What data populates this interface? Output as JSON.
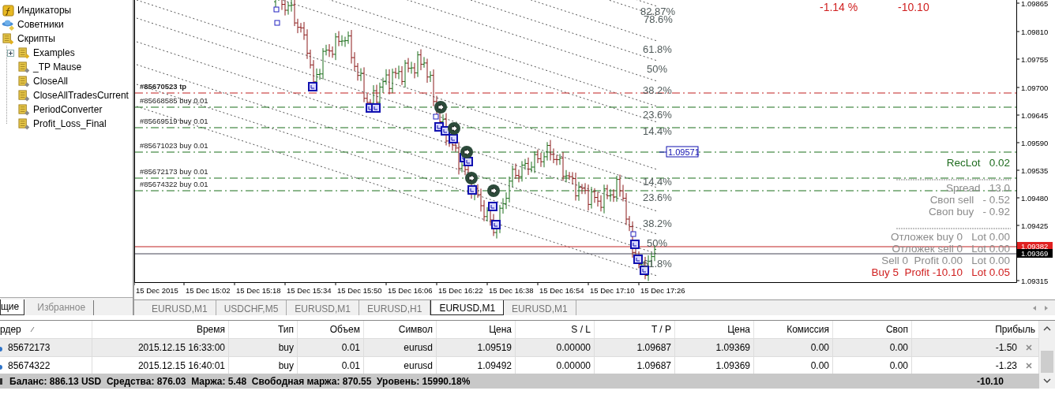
{
  "navigator": {
    "tree": [
      {
        "kind": "indicators",
        "label": "Индикаторы"
      },
      {
        "kind": "experts",
        "label": "Советники"
      },
      {
        "kind": "scripts",
        "label": "Скрипты",
        "children": [
          {
            "kind": "folder",
            "label": "Examples",
            "expanded": false
          },
          {
            "kind": "script",
            "label": "_TP Mause"
          },
          {
            "kind": "script",
            "label": "CloseAll"
          },
          {
            "kind": "script",
            "label": "CloseAllTradesCurrent"
          },
          {
            "kind": "script",
            "label": "PeriodConverter"
          },
          {
            "kind": "script",
            "label": "Profit_Loss_Final"
          }
        ]
      }
    ],
    "tabs": [
      {
        "label": "щие",
        "selected": true
      },
      {
        "label": "Избранное",
        "selected": false
      }
    ]
  },
  "chart": {
    "header": {
      "percent": "-1.14 %",
      "profit": "-10.10"
    },
    "order_lines": [
      {
        "kind": "take_profit",
        "label": "#85670523 tp"
      },
      {
        "kind": "buy",
        "label": "#85668585 buy 0.01"
      },
      {
        "kind": "buy",
        "label": "#85669519 buy 0.01"
      },
      {
        "kind": "buy",
        "label": "#85671023 buy 0.01"
      },
      {
        "kind": "buy",
        "label": "#85672173 buy 0.01"
      },
      {
        "kind": "buy",
        "label": "#85674322 buy 0.01"
      }
    ],
    "fibo_levels": [
      "82.87%",
      "78.6%",
      "61.8%",
      "50%",
      "38.2%",
      "23.6%",
      "14.4%",
      "14.4%",
      "23.6%",
      "38.2%",
      "50%",
      "61.8%"
    ],
    "price_tag": "1.09571",
    "info_panel": [
      {
        "kind": "line",
        "label": "RecLot",
        "value": "0.02",
        "color": "#1e6b1e"
      },
      {
        "kind": "separator"
      },
      {
        "kind": "line",
        "label": "Spread",
        "value": "13.0",
        "color": "#8c8c8c"
      },
      {
        "kind": "line",
        "label": "Своп sell",
        "value": "- 0.52",
        "color": "#8c8c8c"
      },
      {
        "kind": "line",
        "label": "Своп buy",
        "value": "- 0.92",
        "color": "#8c8c8c"
      },
      {
        "kind": "separator"
      },
      {
        "kind": "line",
        "label": "Отложек buy 0",
        "value": "Lot 0.00",
        "color": "#8c8c8c"
      },
      {
        "kind": "line",
        "label": "Отложек sell 0",
        "value": "Lot 0.00",
        "color": "#8c8c8c"
      },
      {
        "kind": "line",
        "label": "Sell 0  Profit 0.00",
        "value": "Lot 0.00",
        "color": "#8c8c8c"
      },
      {
        "kind": "line",
        "label": "Buy 5  Profit -10.10",
        "value": "Lot 0.05",
        "color": "#d01f1f"
      }
    ],
    "price_axis": [
      {
        "kind": "tick",
        "label": "1.09865"
      },
      {
        "kind": "tick",
        "label": "1.09810"
      },
      {
        "kind": "tick",
        "label": "1.09755"
      },
      {
        "kind": "tick",
        "label": "1.09700"
      },
      {
        "kind": "tick",
        "label": "1.09645"
      },
      {
        "kind": "tick",
        "label": "1.09590"
      },
      {
        "kind": "tick",
        "label": "1.09535"
      },
      {
        "kind": "tick",
        "label": "1.09480"
      },
      {
        "kind": "tick",
        "label": "1.09425"
      },
      {
        "kind": "ask",
        "label": "1.09382"
      },
      {
        "kind": "bid",
        "label": "1.09369"
      },
      {
        "kind": "tick",
        "label": "1.09315"
      }
    ],
    "time_axis": [
      "15 Dec 2015",
      "15 Dec 15:02",
      "15 Dec 15:18",
      "15 Dec 15:34",
      "15 Dec 15:50",
      "15 Dec 16:06",
      "15 Dec 16:22",
      "15 Dec 16:38",
      "15 Dec 16:54",
      "15 Dec 17:10",
      "15 Dec 17:26"
    ]
  },
  "chart_tabs": [
    {
      "label": "EURUSD,M1",
      "selected": false
    },
    {
      "label": "USDCHF,M5",
      "selected": false
    },
    {
      "label": "EURUSD,M1",
      "selected": false
    },
    {
      "label": "EURUSD,H1",
      "selected": false
    },
    {
      "label": "EURUSD,M1",
      "selected": true
    },
    {
      "label": "EURUSD,M1",
      "selected": false
    }
  ],
  "terminal": {
    "columns": [
      "рдер",
      "Время",
      "Тип",
      "Объем",
      "Символ",
      "Цена",
      "S / L",
      "T / P",
      "Цена",
      "Комиссия",
      "Своп",
      "Прибыль"
    ],
    "rows": [
      [
        "85672173",
        "2015.12.15 16:33:00",
        "buy",
        "0.01",
        "eurusd",
        "1.09519",
        "0.00000",
        "1.09687",
        "1.09369",
        "0.00",
        "0.00",
        "-1.50"
      ],
      [
        "85674322",
        "2015.12.15 16:40:01",
        "buy",
        "0.01",
        "eurusd",
        "1.09492",
        "0.00000",
        "1.09687",
        "1.09369",
        "0.00",
        "0.00",
        "-1.23"
      ]
    ],
    "summary": "Баланс: 886.13 USD  Средства: 876.03  Маржа: 5.48  Свободная маржа: 870.55  Уровень: 15990.18%",
    "total": "-10.10"
  }
}
